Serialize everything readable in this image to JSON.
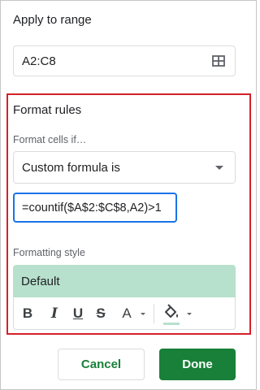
{
  "apply_range": {
    "title": "Apply to range",
    "value": "A2:C8",
    "icon": "select-range-grid-icon"
  },
  "format_rules": {
    "title": "Format rules",
    "condition_label": "Format cells if…",
    "condition_value": "Custom formula is",
    "formula_value": "=countif($A$2:$C$8,A2)>1",
    "highlight_color": "#d4202b"
  },
  "formatting_style": {
    "label": "Formatting style",
    "preview_text": "Default",
    "preview_color": "#b7e1cd",
    "toolbar": {
      "bold": "B",
      "italic": "I",
      "underline": "U",
      "strikethrough": "S",
      "text_color": "A"
    }
  },
  "actions": {
    "cancel_label": "Cancel",
    "done_label": "Done",
    "accent_color": "#188038"
  }
}
